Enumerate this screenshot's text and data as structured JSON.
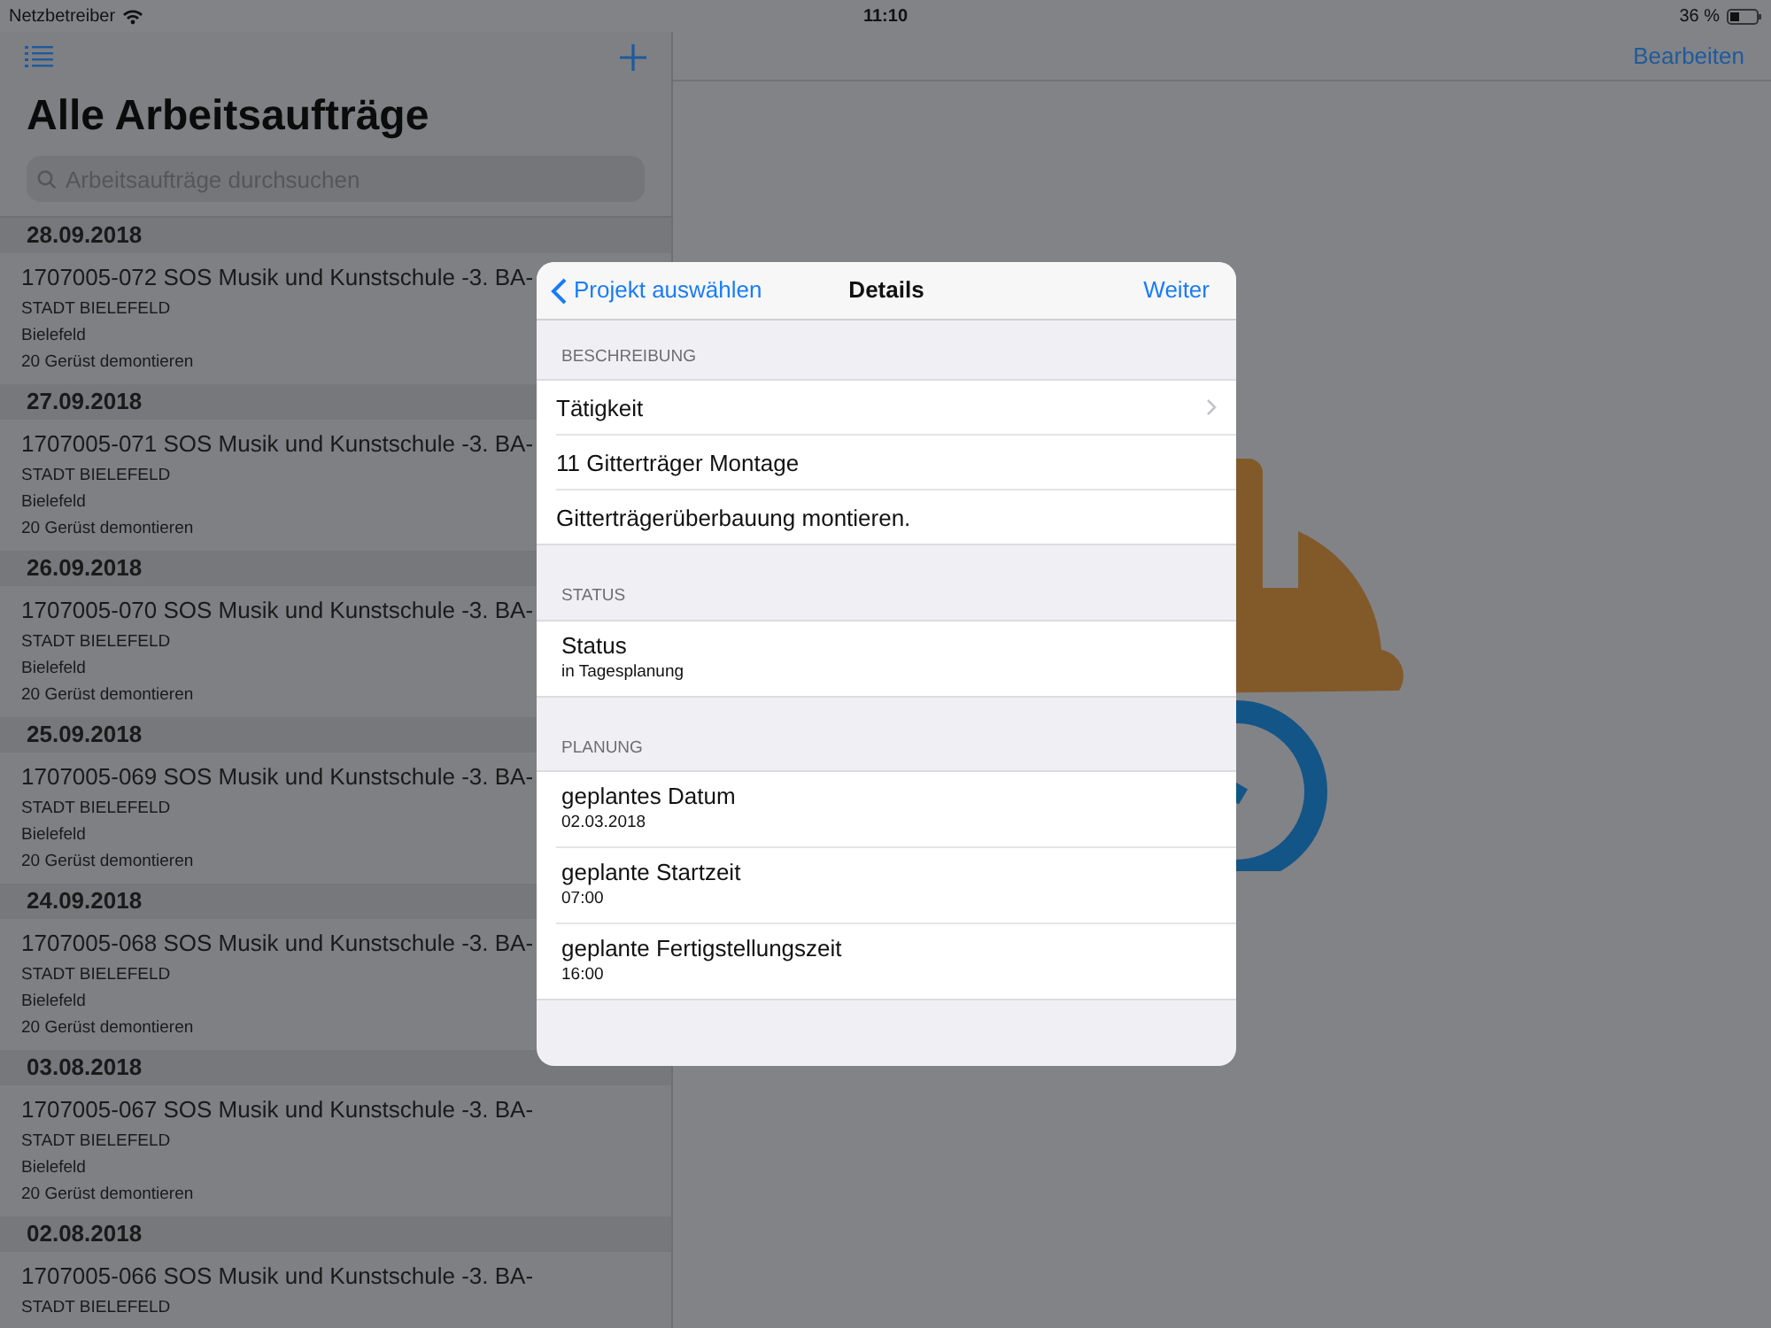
{
  "status_bar": {
    "carrier": "Netzbetreiber",
    "time": "11:10",
    "battery": "36 %"
  },
  "sidebar": {
    "title": "Alle Arbeitsaufträge",
    "search": {
      "placeholder": "Arbeitsaufträge durchsuchen"
    },
    "groups": [
      {
        "date": "28.09.2018",
        "items": [
          {
            "title": "1707005-072 SOS Musik und Kunstschule -3. BA-",
            "client": "STADT BIELEFELD",
            "city": "Bielefeld",
            "task": "20 Gerüst demontieren"
          }
        ]
      },
      {
        "date": "27.09.2018",
        "items": [
          {
            "title": "1707005-071 SOS Musik und Kunstschule -3. BA-",
            "client": "STADT BIELEFELD",
            "city": "Bielefeld",
            "task": "20 Gerüst demontieren"
          }
        ]
      },
      {
        "date": "26.09.2018",
        "items": [
          {
            "title": "1707005-070 SOS Musik und Kunstschule -3. BA-",
            "client": "STADT BIELEFELD",
            "city": "Bielefeld",
            "task": "20 Gerüst demontieren"
          }
        ]
      },
      {
        "date": "25.09.2018",
        "items": [
          {
            "title": "1707005-069 SOS Musik und Kunstschule -3. BA-",
            "client": "STADT BIELEFELD",
            "city": "Bielefeld",
            "task": "20 Gerüst demontieren"
          }
        ]
      },
      {
        "date": "24.09.2018",
        "items": [
          {
            "title": "1707005-068 SOS Musik und Kunstschule -3. BA-",
            "client": "STADT BIELEFELD",
            "city": "Bielefeld",
            "task": "20 Gerüst demontieren"
          }
        ]
      },
      {
        "date": "03.08.2018",
        "items": [
          {
            "title": "1707005-067 SOS Musik und Kunstschule -3. BA-",
            "client": "STADT BIELEFELD",
            "city": "Bielefeld",
            "task": "20 Gerüst demontieren"
          }
        ]
      },
      {
        "date": "02.08.2018",
        "items": [
          {
            "title": "1707005-066 SOS Musik und Kunstschule -3. BA-",
            "client": "STADT BIELEFELD"
          }
        ]
      }
    ]
  },
  "detail": {
    "edit_button": "Bearbeiten"
  },
  "modal": {
    "back": "Projekt auswählen",
    "title": "Details",
    "next": "Weiter",
    "sections": [
      {
        "header": "BESCHREIBUNG",
        "rows": [
          {
            "kind": "disclosure",
            "label": "Tätigkeit"
          },
          {
            "kind": "plain",
            "label": "11 Gitterträger Montage"
          },
          {
            "kind": "plain",
            "label": "Gitterträgerüberbauung montieren."
          }
        ]
      },
      {
        "header": "STATUS",
        "rows": [
          {
            "kind": "subtitle",
            "label": "Status",
            "value": "in Tagesplanung"
          }
        ]
      },
      {
        "header": "PLANUNG",
        "rows": [
          {
            "kind": "subtitle",
            "label": "geplantes Datum",
            "value": "02.03.2018"
          },
          {
            "kind": "subtitle",
            "label": "geplante Startzeit",
            "value": "07:00"
          },
          {
            "kind": "subtitle",
            "label": "geplante Fertigstellungszeit",
            "value": "16:00"
          }
        ]
      }
    ]
  }
}
